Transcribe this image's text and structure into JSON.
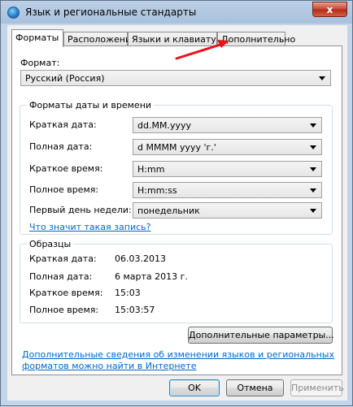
{
  "window": {
    "title": "Язык и региональные стандарты",
    "close_glyph": "x"
  },
  "tabs": [
    {
      "label": "Форматы",
      "active": true
    },
    {
      "label": "Расположение",
      "active": false
    },
    {
      "label": "Языки и клавиатуры",
      "active": false
    },
    {
      "label": "Дополнительно",
      "active": false
    }
  ],
  "format": {
    "label": "Формат:",
    "value": "Русский (Россия)"
  },
  "datetime": {
    "group_title": "Форматы даты и времени",
    "rows": [
      {
        "label": "Краткая дата:",
        "value": "dd.MM.yyyy"
      },
      {
        "label": "Полная дата:",
        "value": "d MMMM yyyy 'г.'"
      },
      {
        "label": "Краткое время:",
        "value": "H:mm"
      },
      {
        "label": "Полное время:",
        "value": "H:mm:ss"
      },
      {
        "label": "Первый день недели:",
        "value": "понедельник"
      }
    ],
    "help_link": "Что значит такая запись?"
  },
  "samples": {
    "group_title": "Образцы",
    "rows": [
      {
        "label": "Краткая дата:",
        "value": "06.03.2013"
      },
      {
        "label": "Полная дата:",
        "value": "6 марта 2013 г."
      },
      {
        "label": "Краткое время:",
        "value": "15:03"
      },
      {
        "label": "Полное время:",
        "value": "15:03:57"
      }
    ]
  },
  "additional_button": "Дополнительные параметры...",
  "info_link_line1": "Дополнительные сведения об изменении языков и региональных",
  "info_link_line2": "форматов можно найти в Интернете",
  "buttons": {
    "ok": "OK",
    "cancel": "Отмена",
    "apply": "Применить"
  },
  "colors": {
    "annotation_arrow": "#e8131b",
    "link": "#0066cc"
  }
}
